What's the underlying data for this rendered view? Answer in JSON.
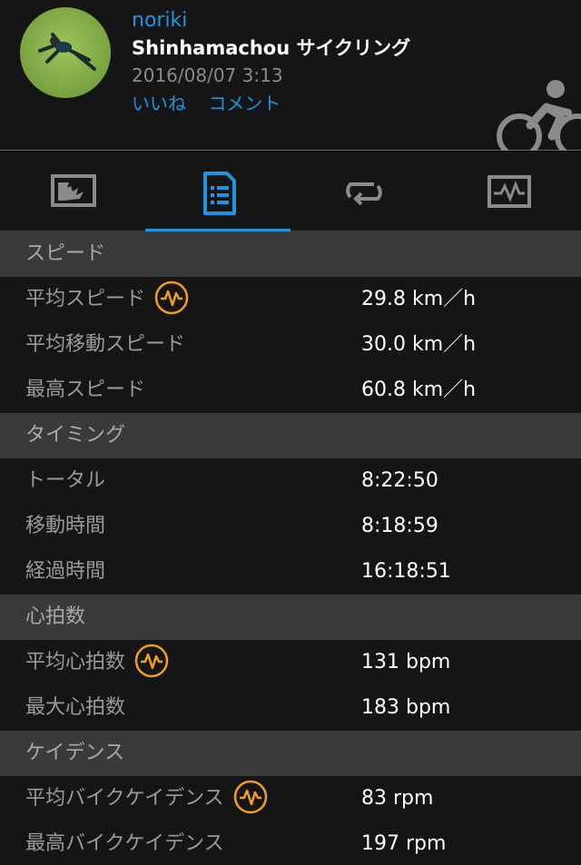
{
  "header": {
    "username": "noriki",
    "activity_title": "Shinhamachou サイクリング",
    "timestamp": "2016/08/07 3:13",
    "like_label": "いいね",
    "comment_label": "コメント",
    "activity_icon": "bike-icon"
  },
  "tabs": [
    {
      "icon": "summary-chart-icon",
      "active": false
    },
    {
      "icon": "details-list-icon",
      "active": true
    },
    {
      "icon": "laps-loop-icon",
      "active": false
    },
    {
      "icon": "graph-monitor-icon",
      "active": false
    }
  ],
  "sections": {
    "speed": {
      "title": "スピード",
      "rows": [
        {
          "label": "平均スピード",
          "value": "29.8 km／h"
        },
        {
          "label": "平均移動スピード",
          "value": "30.0 km／h"
        },
        {
          "label": "最高スピード",
          "value": "60.8 km／h"
        }
      ]
    },
    "timing": {
      "title": "タイミング",
      "rows": [
        {
          "label": "トータル",
          "value": "8:22:50"
        },
        {
          "label": "移動時間",
          "value": "8:18:59"
        },
        {
          "label": "経過時間",
          "value": "16:18:51"
        }
      ]
    },
    "heart_rate": {
      "title": "心拍数",
      "rows": [
        {
          "label": "平均心拍数",
          "value": "131 bpm"
        },
        {
          "label": "最大心拍数",
          "value": "183 bpm"
        }
      ]
    },
    "cadence": {
      "title": "ケイデンス",
      "rows": [
        {
          "label": "平均バイクケイデンス",
          "value": "83 rpm"
        },
        {
          "label": "最高バイクケイデンス",
          "value": "197 rpm"
        }
      ]
    }
  },
  "colors": {
    "accent": "#1f95e0",
    "badge_orange": "#f0a020",
    "background": "#151515",
    "section_header": "#3a3a3a"
  }
}
